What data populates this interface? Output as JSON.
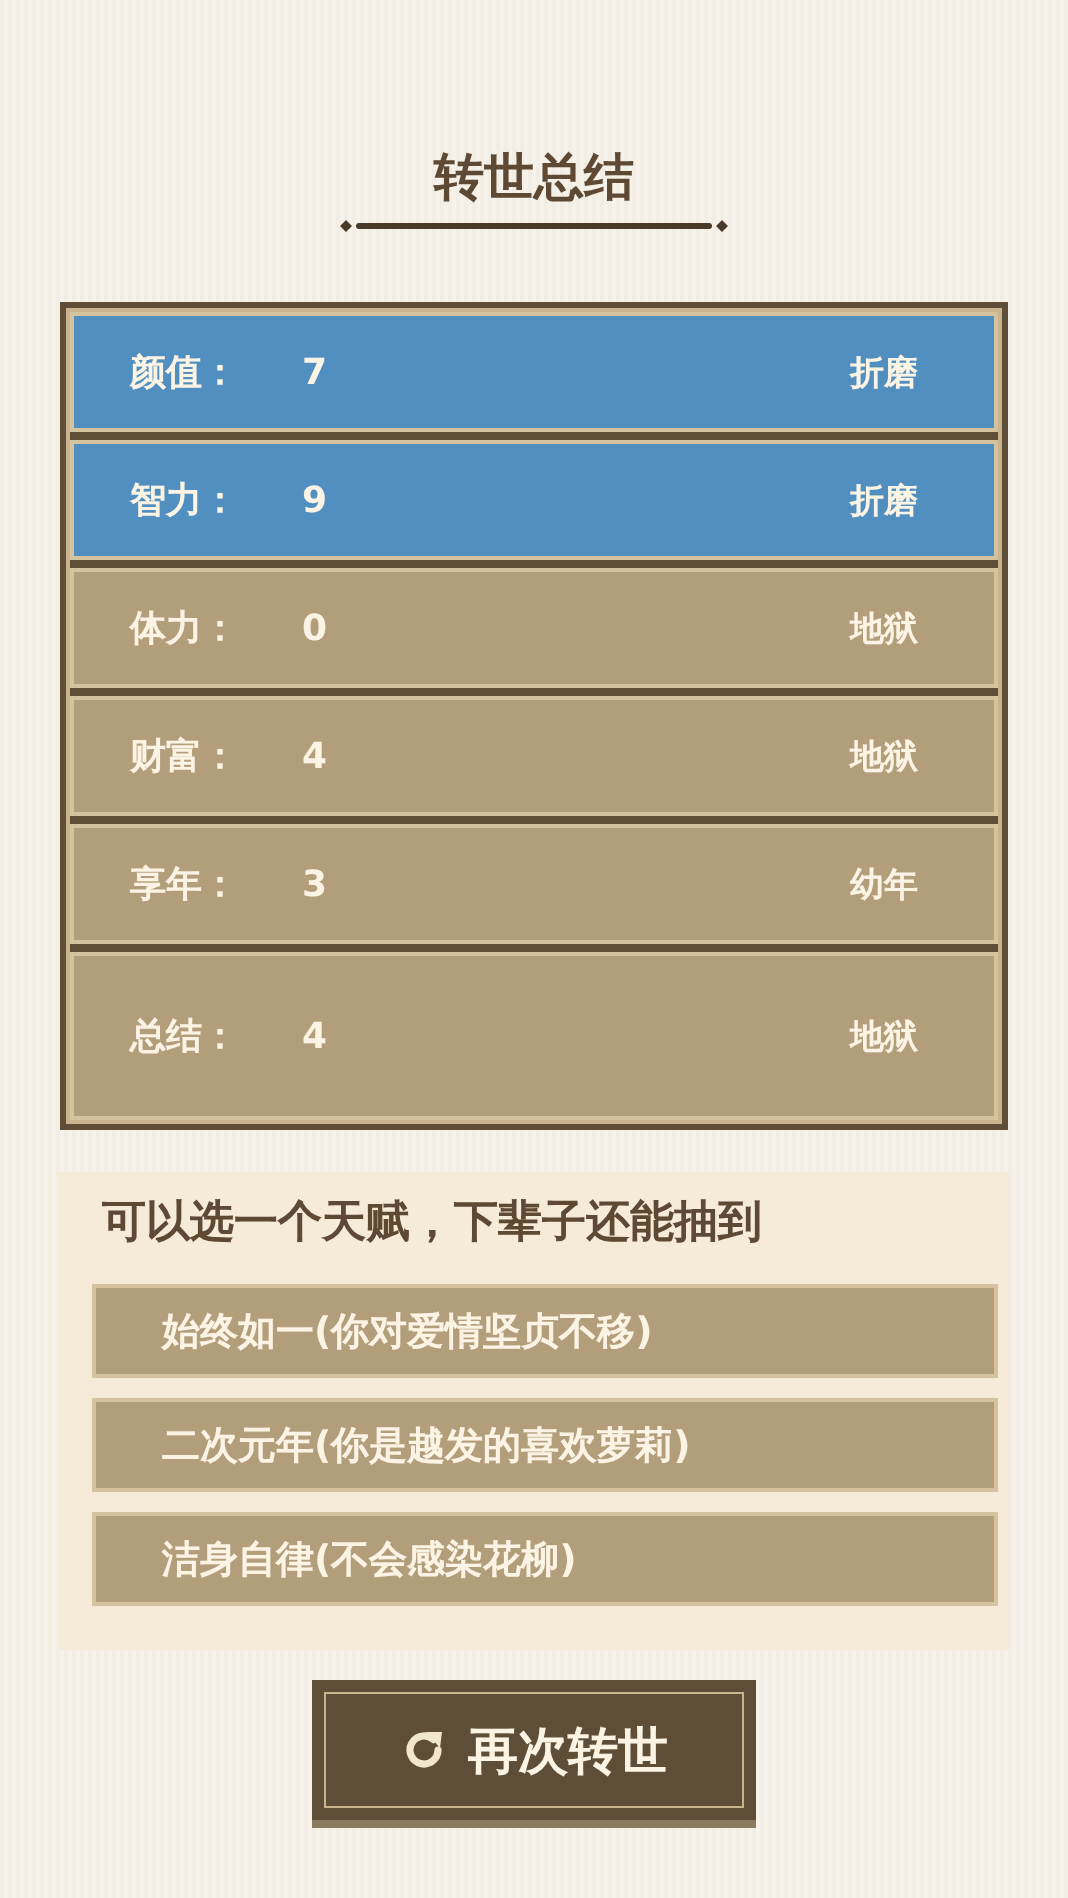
{
  "title": "转世总结",
  "stats": [
    {
      "label": "颜值：",
      "value": "7",
      "grade": "折磨",
      "color": "#508fbf"
    },
    {
      "label": "智力：",
      "value": "9",
      "grade": "折磨",
      "color": "#508fbf"
    },
    {
      "label": "体力：",
      "value": "0",
      "grade": "地狱",
      "color": "#b39e7c"
    },
    {
      "label": "财富：",
      "value": "4",
      "grade": "地狱",
      "color": "#b39e7c"
    },
    {
      "label": "享年：",
      "value": "3",
      "grade": "幼年",
      "color": "#b39e7c"
    },
    {
      "label": "总结：",
      "value": "4",
      "grade": "地狱",
      "color": "#b39e7c",
      "kind": "summary"
    }
  ],
  "talents": {
    "heading": "可以选一个天赋，下辈子还能抽到",
    "items": [
      {
        "label": "始终如一(你对爱情坚贞不移)"
      },
      {
        "label": "二次元年(你是越发的喜欢萝莉)"
      },
      {
        "label": "洁身自律(不会感染花柳)"
      }
    ]
  },
  "restart_button": {
    "label": "再次转世"
  }
}
